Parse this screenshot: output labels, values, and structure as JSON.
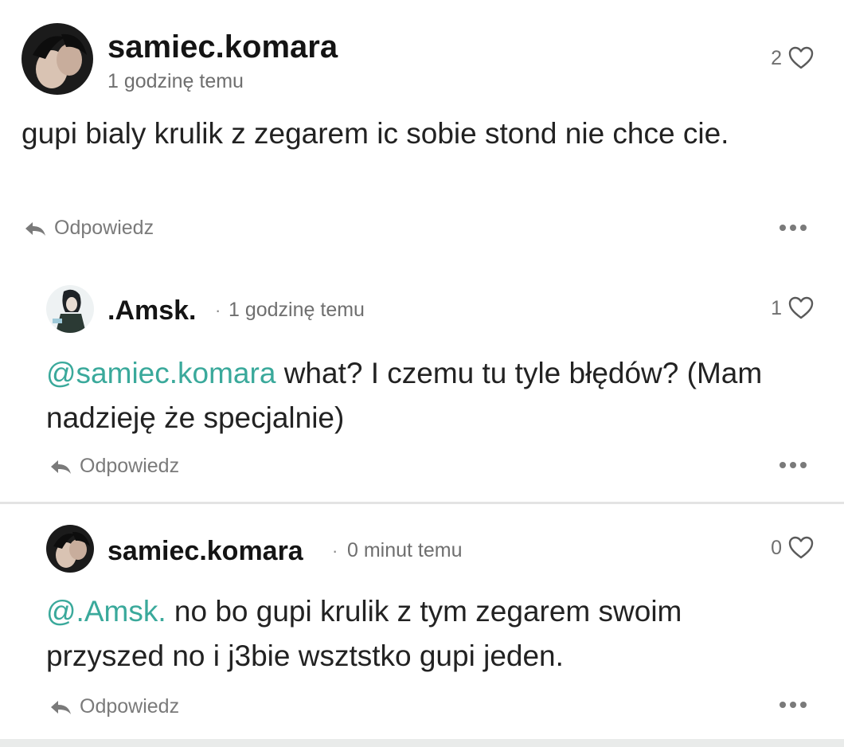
{
  "comments": [
    {
      "username": "samiec.komara",
      "time": "1 godzinę temu",
      "likes": "2",
      "text": "gupi bialy krulik z zegarem ic sobie stond nie chce cie.",
      "reply_label": "Odpowiedz"
    },
    {
      "username": ".Amsk.",
      "separator": "·",
      "time": "1 godzinę temu",
      "likes": "1",
      "mention": "@samiec.komara",
      "text": " what? I czemu tu tyle błędów? (Mam nadzieję że specjalnie)",
      "reply_label": "Odpowiedz"
    },
    {
      "username": "samiec.komara",
      "separator": "·",
      "time": "0 minut temu",
      "likes": "0",
      "mention": "@.Amsk.",
      "text": " no bo gupi krulik z tym zegarem swoim przyszed no i j3bie wsztstko gupi jeden.",
      "reply_label": "Odpowiedz"
    }
  ],
  "colors": {
    "mention": "#3aa99b",
    "text": "#222222",
    "meta": "#6f6f6f"
  },
  "icons": {
    "like": "heart-outline-icon",
    "reply": "reply-arrow-icon",
    "more": "more-dots-icon"
  }
}
